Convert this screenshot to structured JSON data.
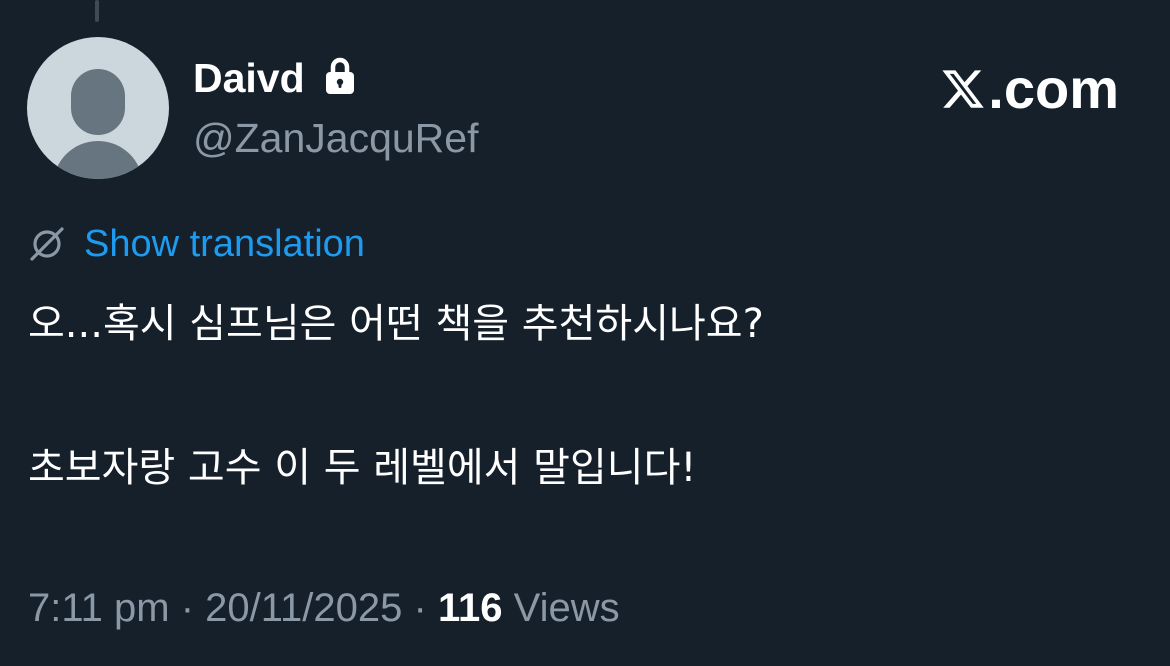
{
  "user": {
    "display_name": "Daivd",
    "handle": "@ZanJacquRef",
    "protected_icon": "lock-icon",
    "avatar": "default-avatar"
  },
  "brand": {
    "logo_icon": "x-logo-icon",
    "label": ".com"
  },
  "translation": {
    "icon": "translate-globe-icon",
    "label": "Show translation",
    "color": "#1d9bf0"
  },
  "tweet": {
    "lines": [
      "오...혹시 심프님은 어떤 책을 추천하시나요?",
      "",
      "초보자랑 고수 이 두 레벨에서 말입니다!"
    ]
  },
  "meta": {
    "time": "7:11 pm",
    "separator": "·",
    "date": "20/11/2025",
    "views_count": "116",
    "views_label": "Views"
  },
  "colors": {
    "background": "#15202b",
    "text_primary": "#ffffff",
    "text_secondary": "#8b98a5",
    "accent": "#1d9bf0"
  }
}
